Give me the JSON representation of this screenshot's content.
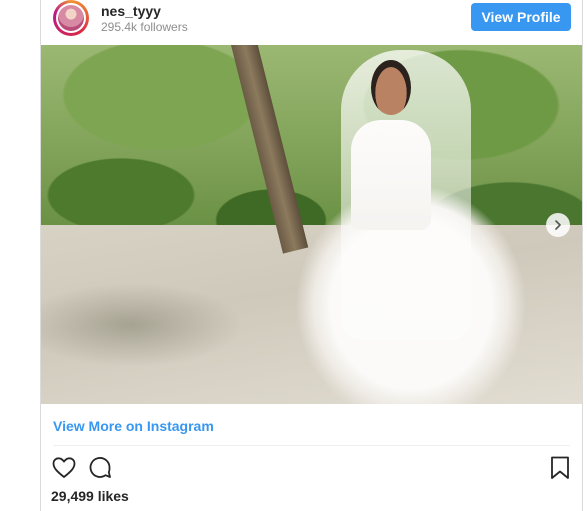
{
  "profile": {
    "username": "nes_tyyy",
    "followers": "295.4k followers",
    "view_profile_label": "View Profile"
  },
  "post": {
    "view_more_label": "View More on Instagram",
    "likes": "29,499 likes"
  },
  "icons": {
    "like": "heart-icon",
    "comment": "comment-icon",
    "save": "bookmark-icon",
    "next": "chevron-right-icon"
  },
  "colors": {
    "accent": "#3897f0",
    "text": "#262626",
    "muted": "#8e8e8e",
    "border": "#dbdbdb"
  }
}
